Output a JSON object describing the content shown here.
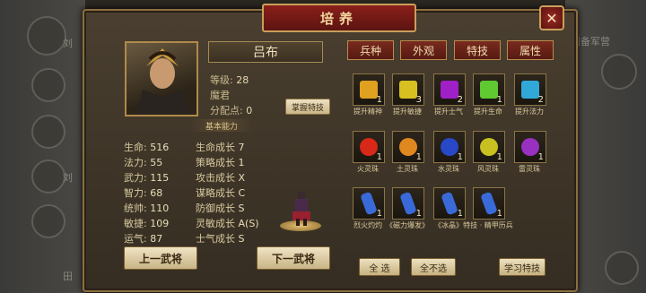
{
  "window": {
    "title": "培养",
    "close_label": "✕"
  },
  "hero": {
    "name": "吕布",
    "level_label": "等级:",
    "level": "28",
    "type": "魔君",
    "points_label": "分配点:",
    "points": "0",
    "master_skill_button": "掌握特技"
  },
  "section_title": "基本能力",
  "stats": [
    {
      "label": "生命:",
      "value": "516",
      "growth_label": "生命成长",
      "growth": "7"
    },
    {
      "label": "法力:",
      "value": "55",
      "growth_label": "策略成长",
      "growth": "1"
    },
    {
      "label": "武力:",
      "value": "115",
      "growth_label": "攻击成长",
      "growth": "X"
    },
    {
      "label": "智力:",
      "value": "68",
      "growth_label": "谋略成长",
      "growth": "C"
    },
    {
      "label": "统帅:",
      "value": "110",
      "growth_label": "防御成长",
      "growth": "S"
    },
    {
      "label": "敏捷:",
      "value": "109",
      "growth_label": "灵敏成长",
      "growth": "A(S)"
    },
    {
      "label": "运气:",
      "value": "87",
      "growth_label": "士气成长",
      "growth": "S"
    }
  ],
  "nav": {
    "prev_hero": "上一武将",
    "next_hero": "下一武将"
  },
  "tabs": [
    "兵种",
    "外观",
    "特技",
    "属性"
  ],
  "items": [
    {
      "label": "提升精神",
      "count": "1",
      "color": "#e0a020"
    },
    {
      "label": "提升敏捷",
      "count": "3",
      "color": "#d8c020"
    },
    {
      "label": "提升士气",
      "count": "2",
      "color": "#a020c8"
    },
    {
      "label": "提升生命",
      "count": "1",
      "color": "#60c830"
    },
    {
      "label": "提升法力",
      "count": "2",
      "color": "#30a8d8"
    },
    {
      "label": "火灵珠",
      "count": "1",
      "color": "#d82818"
    },
    {
      "label": "土灵珠",
      "count": "1",
      "color": "#e08820"
    },
    {
      "label": "水灵珠",
      "count": "1",
      "color": "#2848c8"
    },
    {
      "label": "风灵珠",
      "count": "1",
      "color": "#c8c020"
    },
    {
      "label": "雷灵珠",
      "count": "1",
      "color": "#9830c0"
    },
    {
      "label": "烈火灼灼",
      "count": "1",
      "color": "#3a6ad8"
    },
    {
      "label": "《磁力爆发》",
      "count": "1",
      "color": "#3a6ad8"
    },
    {
      "label": "《冰晶》",
      "count": "1",
      "color": "#3a6ad8"
    },
    {
      "label": "特技 · 精甲历兵",
      "count": "1",
      "color": "#3a6ad8"
    }
  ],
  "actions": {
    "select_all": "全 选",
    "select_none": "全不选",
    "learn_skill": "学习特技"
  },
  "background": {
    "left_labels": [
      "刘",
      "田",
      "刘"
    ],
    "right_label": "刘备军营"
  }
}
